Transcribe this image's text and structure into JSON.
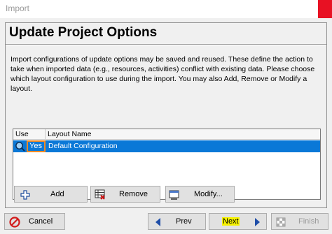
{
  "window": {
    "title": "Import"
  },
  "panel": {
    "title": "Update Project Options",
    "description": "Import configurations of update options may be saved and reused.  These define the action to take when imported data (e.g., resources, activities) conflict with existing data. Please choose which layout configuration to use during the import. You may also Add, Remove or Modify a layout."
  },
  "table": {
    "columns": {
      "use": "Use",
      "layout_name": "Layout Name"
    },
    "rows": [
      {
        "use": "Yes",
        "layout_name": "Default Configuration",
        "selected": true
      }
    ]
  },
  "actions": {
    "add": "Add",
    "remove": "Remove",
    "modify": "Modify..."
  },
  "nav": {
    "cancel": "Cancel",
    "prev": "Prev",
    "next": "Next",
    "finish": "Finish"
  },
  "colors": {
    "selection": "#0a78d7",
    "highlight_border": "#f08a24",
    "next_highlight": "#f5f100",
    "close": "#e81123"
  },
  "icons": {
    "add": "plus-icon",
    "remove": "remove-grid-icon",
    "modify": "modify-icon",
    "cancel": "cancel-icon",
    "prev": "arrow-left-icon",
    "next": "arrow-right-icon",
    "finish": "finish-flag-icon",
    "row": "search-magnifier-icon"
  }
}
